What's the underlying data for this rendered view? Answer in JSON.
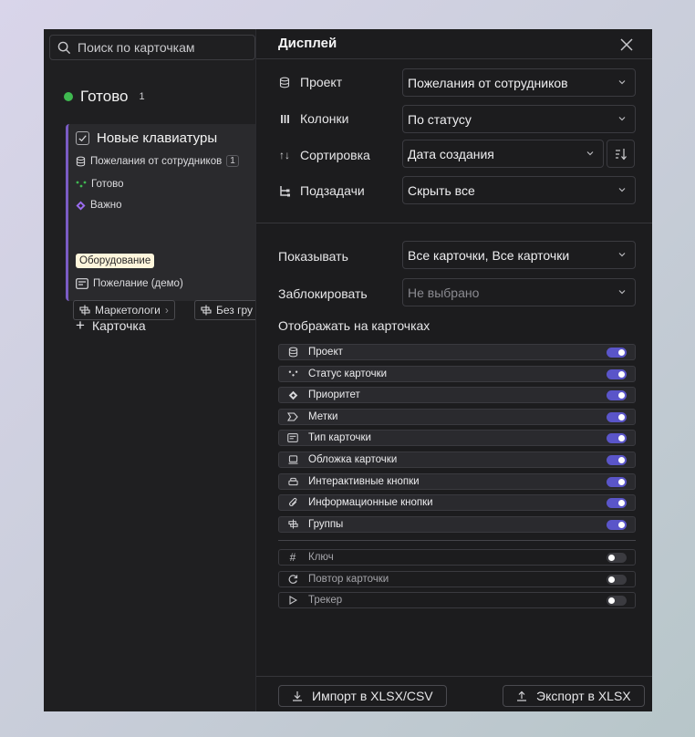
{
  "search": {
    "placeholder": "Поиск по карточкам"
  },
  "column": {
    "title": "Готово",
    "count": "1",
    "add_label": "Карточка",
    "status_color": "#3fb950"
  },
  "card": {
    "title": "Новые клавиатуры",
    "project": "Пожелания от сотрудников",
    "project_badge": "1",
    "status": "Готово",
    "priority": "Важно",
    "tag": "Оборудование",
    "type": "Пожелание (демо)",
    "group1": "Маркетологи",
    "group2": "Без гру",
    "accent_color": "#7a5cc4"
  },
  "panel": {
    "title": "Дисплей",
    "fields": [
      {
        "label": "Проект",
        "icon": "database-icon",
        "value": "Пожелания от сотрудников"
      },
      {
        "label": "Колонки",
        "icon": "columns-icon",
        "value": "По статусу"
      },
      {
        "label": "Сортировка",
        "icon": "sort-arrows-icon",
        "value": "Дата создания"
      },
      {
        "label": "Подзадачи",
        "icon": "subtasks-icon",
        "value": "Скрыть все"
      }
    ],
    "show_label": "Показывать",
    "show_value": "Все карточки, Все карточки",
    "lock_label": "Заблокировать",
    "lock_value": "Не выбрано",
    "display_section": "Отображать на карточках",
    "toggles_on": [
      {
        "label": "Проект",
        "icon": "database-icon",
        "on": true
      },
      {
        "label": "Статус карточки",
        "icon": "status-dots-icon",
        "on": true
      },
      {
        "label": "Приоритет",
        "icon": "priority-diamond-icon",
        "on": true
      },
      {
        "label": "Метки",
        "icon": "tag-icon",
        "on": true
      },
      {
        "label": "Тип карточки",
        "icon": "card-type-icon",
        "on": true
      },
      {
        "label": "Обложка карточки",
        "icon": "cover-icon",
        "on": true
      },
      {
        "label": "Интерактивные кнопки",
        "icon": "interactive-buttons-icon",
        "on": true
      },
      {
        "label": "Информационные кнопки",
        "icon": "paperclip-icon",
        "on": true
      },
      {
        "label": "Группы",
        "icon": "groups-icon",
        "on": true
      }
    ],
    "toggles_off": [
      {
        "label": "Ключ",
        "icon": "hash-icon",
        "on": false
      },
      {
        "label": "Повтор карточки",
        "icon": "repeat-icon",
        "on": false
      },
      {
        "label": "Трекер",
        "icon": "play-icon",
        "on": false
      }
    ],
    "import_label": "Импорт в XLSX/CSV",
    "export_label": "Экспорт в XLSX",
    "accent_color": "#5a55c9"
  }
}
